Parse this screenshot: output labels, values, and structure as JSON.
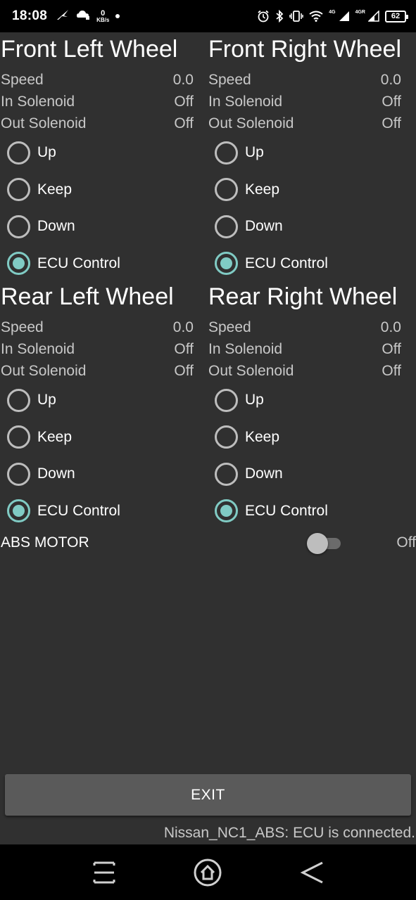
{
  "status_bar": {
    "time": "18:08",
    "net_speed_value": "0",
    "net_speed_unit": "KB/s",
    "net_label_1": "4G",
    "net_label_2": "4GR",
    "battery": "62",
    "icons": [
      "fan-icon",
      "cloud-icon",
      "alarm-icon",
      "bluetooth-icon",
      "vibrate-icon",
      "wifi-icon",
      "signal-icon",
      "battery-icon"
    ]
  },
  "wheels": [
    {
      "title": "Front Left Wheel",
      "speed_label": "Speed",
      "speed_value": "0.0",
      "in_label": "In Solenoid",
      "in_value": "Off",
      "out_label": "Out Solenoid",
      "out_value": "Off",
      "options": [
        "Up",
        "Keep",
        "Down",
        "ECU Control"
      ],
      "selected": "ECU Control"
    },
    {
      "title": "Front Right Wheel",
      "speed_label": "Speed",
      "speed_value": "0.0",
      "in_label": "In Solenoid",
      "in_value": "Off",
      "out_label": "Out Solenoid",
      "out_value": "Off",
      "options": [
        "Up",
        "Keep",
        "Down",
        "ECU Control"
      ],
      "selected": "ECU Control"
    },
    {
      "title": "Rear Left Wheel",
      "speed_label": "Speed",
      "speed_value": "0.0",
      "in_label": "In Solenoid",
      "in_value": "Off",
      "out_label": "Out Solenoid",
      "out_value": "Off",
      "options": [
        "Up",
        "Keep",
        "Down",
        "ECU Control"
      ],
      "selected": "ECU Control"
    },
    {
      "title": "Rear Right Wheel",
      "speed_label": "Speed",
      "speed_value": "0.0",
      "in_label": "In Solenoid",
      "in_value": "Off",
      "out_label": "Out Solenoid",
      "out_value": "Off",
      "options": [
        "Up",
        "Keep",
        "Down",
        "ECU Control"
      ],
      "selected": "ECU Control"
    }
  ],
  "abs_motor": {
    "label": "ABS MOTOR",
    "state": "Off",
    "on": false
  },
  "exit_button": "EXIT",
  "connection_status": "Nissan_NC1_ABS: ECU is connected.",
  "nav": [
    "menu-icon",
    "home-icon",
    "back-icon"
  ],
  "colors": {
    "background": "#303030",
    "accent": "#80cbc4",
    "button": "#5a5a5a"
  }
}
